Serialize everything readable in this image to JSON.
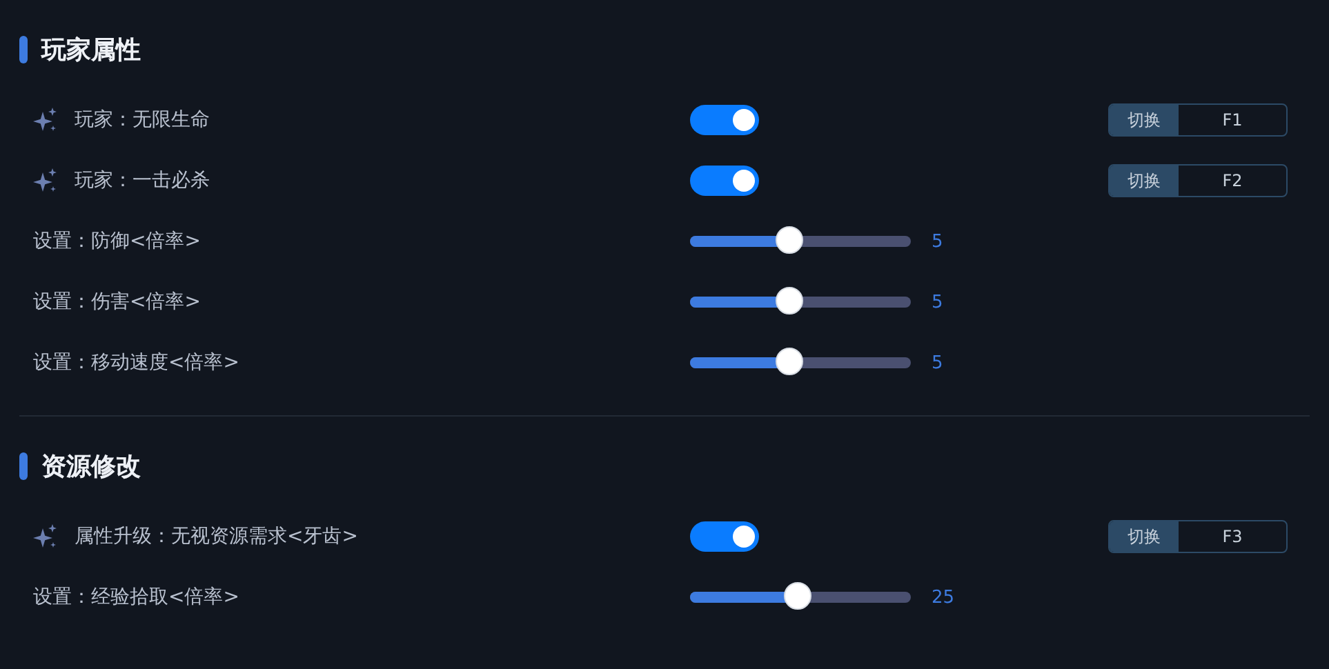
{
  "sections": [
    {
      "title": "玩家属性",
      "rows": [
        {
          "kind": "toggle",
          "icon": true,
          "label": "玩家：无限生命",
          "on": true,
          "hotkey_label": "切换",
          "hotkey": "F1"
        },
        {
          "kind": "toggle",
          "icon": true,
          "label": "玩家：一击必杀",
          "on": true,
          "hotkey_label": "切换",
          "hotkey": "F2"
        },
        {
          "kind": "slider",
          "label": "设置：防御<倍率>",
          "level": 0.45,
          "reading": "5"
        },
        {
          "kind": "slider",
          "label": "设置：伤害<倍率>",
          "level": 0.45,
          "reading": "5"
        },
        {
          "kind": "slider",
          "label": "设置：移动速度<倍率>",
          "level": 0.45,
          "reading": "5"
        }
      ]
    },
    {
      "title": "资源修改",
      "rows": [
        {
          "kind": "toggle",
          "icon": true,
          "label": "属性升级：无视资源需求<牙齿>",
          "on": true,
          "hotkey_label": "切换",
          "hotkey": "F3"
        },
        {
          "kind": "slider",
          "label": "设置：经验拾取<倍率>",
          "level": 0.49,
          "reading": "25"
        }
      ]
    }
  ]
}
